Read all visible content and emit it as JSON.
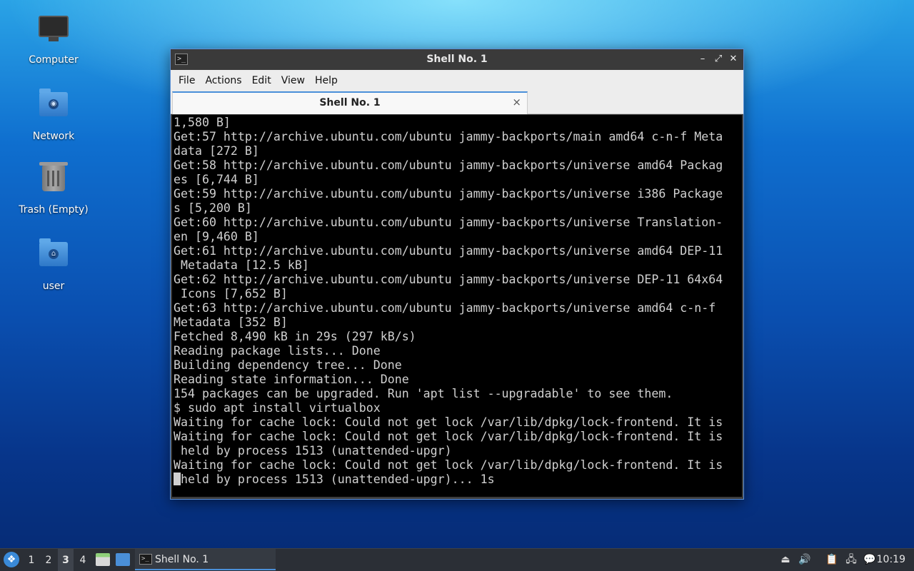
{
  "desktop": {
    "icons": [
      {
        "label": "Computer"
      },
      {
        "label": "Network"
      },
      {
        "label": "Trash (Empty)"
      },
      {
        "label": "user"
      }
    ]
  },
  "window": {
    "title": "Shell No. 1",
    "menu": [
      "File",
      "Actions",
      "Edit",
      "View",
      "Help"
    ],
    "tab_label": "Shell No. 1",
    "tab_close": "×",
    "controls": {
      "minimize": "–",
      "maximize": "⤢",
      "close": "✕"
    }
  },
  "terminal": {
    "lines": [
      "1,580 B]",
      "Get:57 http://archive.ubuntu.com/ubuntu jammy-backports/main amd64 c-n-f Meta",
      "data [272 B]",
      "Get:58 http://archive.ubuntu.com/ubuntu jammy-backports/universe amd64 Packag",
      "es [6,744 B]",
      "Get:59 http://archive.ubuntu.com/ubuntu jammy-backports/universe i386 Package",
      "s [5,200 B]",
      "Get:60 http://archive.ubuntu.com/ubuntu jammy-backports/universe Translation-",
      "en [9,460 B]",
      "Get:61 http://archive.ubuntu.com/ubuntu jammy-backports/universe amd64 DEP-11",
      " Metadata [12.5 kB]",
      "Get:62 http://archive.ubuntu.com/ubuntu jammy-backports/universe DEP-11 64x64",
      " Icons [7,652 B]",
      "Get:63 http://archive.ubuntu.com/ubuntu jammy-backports/universe amd64 c-n-f",
      "Metadata [352 B]",
      "Fetched 8,490 kB in 29s (297 kB/s)",
      "Reading package lists... Done",
      "Building dependency tree... Done",
      "Reading state information... Done",
      "154 packages can be upgraded. Run 'apt list --upgradable' to see them.",
      "$ sudo apt install virtualbox",
      "Waiting for cache lock: Could not get lock /var/lib/dpkg/lock-frontend. It is",
      "Waiting for cache lock: Could not get lock /var/lib/dpkg/lock-frontend. It is",
      " held by process 1513 (unattended-upgr)",
      "Waiting for cache lock: Could not get lock /var/lib/dpkg/lock-frontend. It is"
    ],
    "last_line": "held by process 1513 (unattended-upgr)... 1s"
  },
  "taskbar": {
    "workspaces": [
      "1",
      "2",
      "3",
      "4"
    ],
    "active_workspace": "3",
    "task_label": "Shell No. 1",
    "clock": "10:19",
    "tray_icons": [
      "show-desktop-icon",
      "volume-icon",
      "clipboard-icon",
      "network-icon",
      "notification-icon"
    ]
  }
}
